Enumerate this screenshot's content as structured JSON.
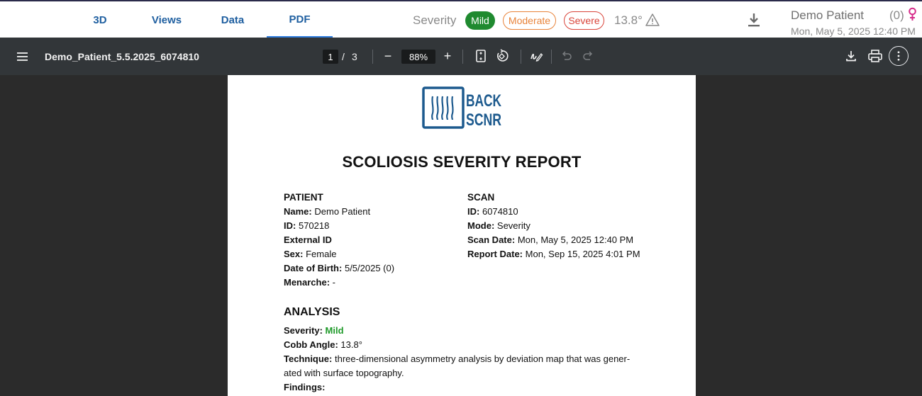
{
  "tabs": [
    {
      "label": "3D"
    },
    {
      "label": "Views"
    },
    {
      "label": "Data"
    },
    {
      "label": "PDF",
      "active": true
    }
  ],
  "severity": {
    "label": "Severity",
    "mild": "Mild",
    "moderate": "Moderate",
    "severe": "Severe",
    "selected": "Mild",
    "angle": "13.8°",
    "colors": {
      "mild": "#1f8a2f",
      "moderate": "#e8833a",
      "severe": "#d9443a"
    }
  },
  "patient": {
    "name": "Demo Patient",
    "count": "(0)",
    "datetime": "Mon, May 5, 2025 12:40 PM"
  },
  "pdf_toolbar": {
    "filename": "Demo_Patient_5.5.2025_6074810",
    "page_current": "1",
    "page_sep": "/",
    "page_total": "3",
    "zoom_minus": "−",
    "zoom": "88%",
    "zoom_plus": "+"
  },
  "report": {
    "logo_line1": "BACK",
    "logo_line2": "SCNR",
    "title": "SCOLIOSIS SEVERITY REPORT",
    "patient": {
      "heading": "PATIENT",
      "name_label": "Name:",
      "name": "Demo Patient",
      "id_label": "ID:",
      "id": "570218",
      "external_label": "External ID",
      "sex_label": "Sex:",
      "sex": "Female",
      "dob_label": "Date of Birth:",
      "dob": "5/5/2025 (0)",
      "menarche_label": "Menarche:",
      "menarche": "-"
    },
    "scan": {
      "heading": "SCAN",
      "id_label": "ID:",
      "id": "6074810",
      "mode_label": "Mode:",
      "mode": "Severity",
      "scan_date_label": "Scan Date:",
      "scan_date": "Mon, May 5, 2025 12:40 PM",
      "report_date_label": "Report Date:",
      "report_date": "Mon, Sep 15, 2025 4:01 PM"
    },
    "analysis": {
      "heading": "ANALYSIS",
      "severity_label": "Severity:",
      "severity": "Mild",
      "cobb_label": "Cobb Angle:",
      "cobb": "13.8°",
      "technique_label": "Technique:",
      "technique_line1": "three-dimensional asymmetry analysis by deviation map that was gener-",
      "technique_line2": "ated with surface topography.",
      "findings_label": "Findings:"
    }
  }
}
